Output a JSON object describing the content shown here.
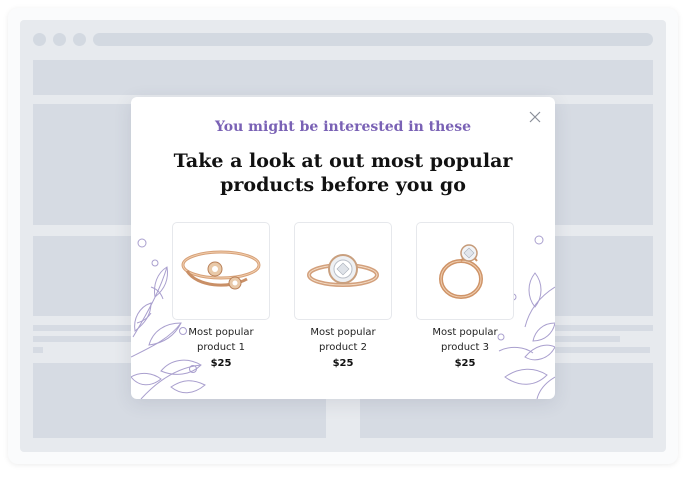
{
  "popup": {
    "subtitle": "You might be interested in these",
    "title_line1": "Take a look at out most popular",
    "title_line2": "products before you go",
    "accent_color": "#7a62b5"
  },
  "products": [
    {
      "name_line1": "Most popular",
      "name_line2": "product 1",
      "price": "$25",
      "image": "open-ring-flower-image"
    },
    {
      "name_line1": "Most popular",
      "name_line2": "product 2",
      "price": "$25",
      "image": "halo-diamond-ring-image"
    },
    {
      "name_line1": "Most popular",
      "name_line2": "product 3",
      "price": "$25",
      "image": "solitaire-ring-image"
    }
  ],
  "icons": {
    "close": "close-icon"
  }
}
